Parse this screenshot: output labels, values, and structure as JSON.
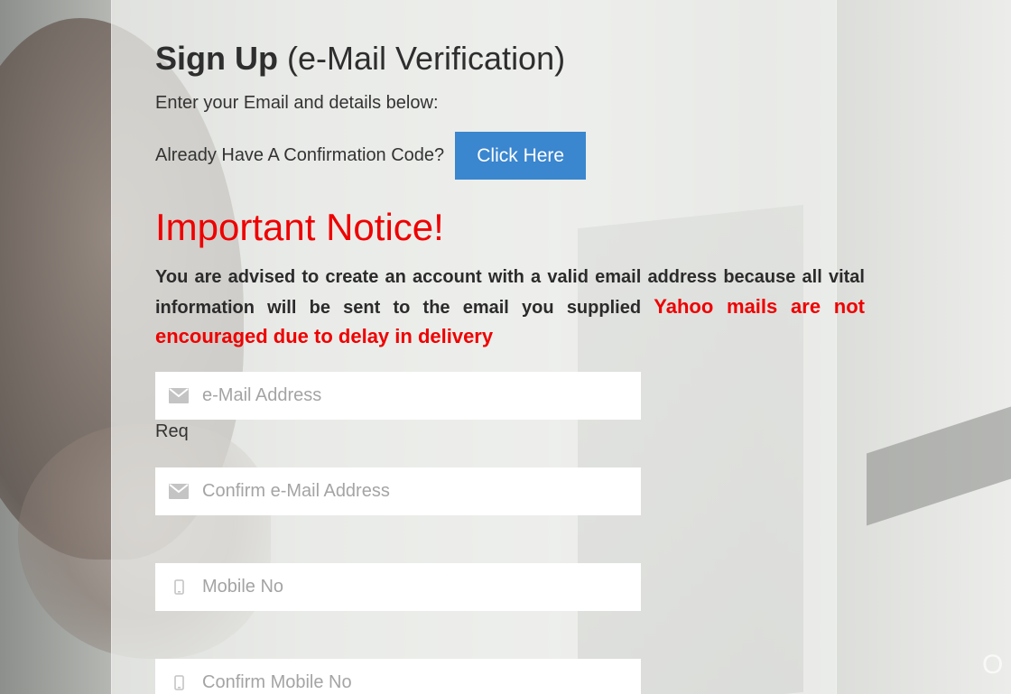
{
  "header": {
    "title_bold": "Sign Up",
    "title_rest": "(e-Mail Verification)",
    "subtitle": "Enter your Email and details below:"
  },
  "confirmation": {
    "text": "Already Have A Confirmation Code?",
    "button_label": "Click Here",
    "button_color": "#3a86cf"
  },
  "notice": {
    "title": "Important Notice!",
    "body": "You are advised to create an account with a valid email address because all vital information will be sent to the email you supplied",
    "warning": "Yahoo mails are not encouraged due to delay in delivery",
    "color": "#ee0000"
  },
  "form": {
    "email": {
      "placeholder": "e-Mail Address",
      "value": "",
      "icon": "envelope-icon"
    },
    "email_req": "Req",
    "confirm_email": {
      "placeholder": "Confirm e-Mail Address",
      "value": "",
      "icon": "envelope-icon"
    },
    "mobile": {
      "placeholder": "Mobile No",
      "value": "",
      "icon": "mobile-phone-icon"
    },
    "confirm_mobile": {
      "placeholder": "Confirm Mobile No",
      "value": "",
      "icon": "mobile-phone-icon"
    }
  }
}
